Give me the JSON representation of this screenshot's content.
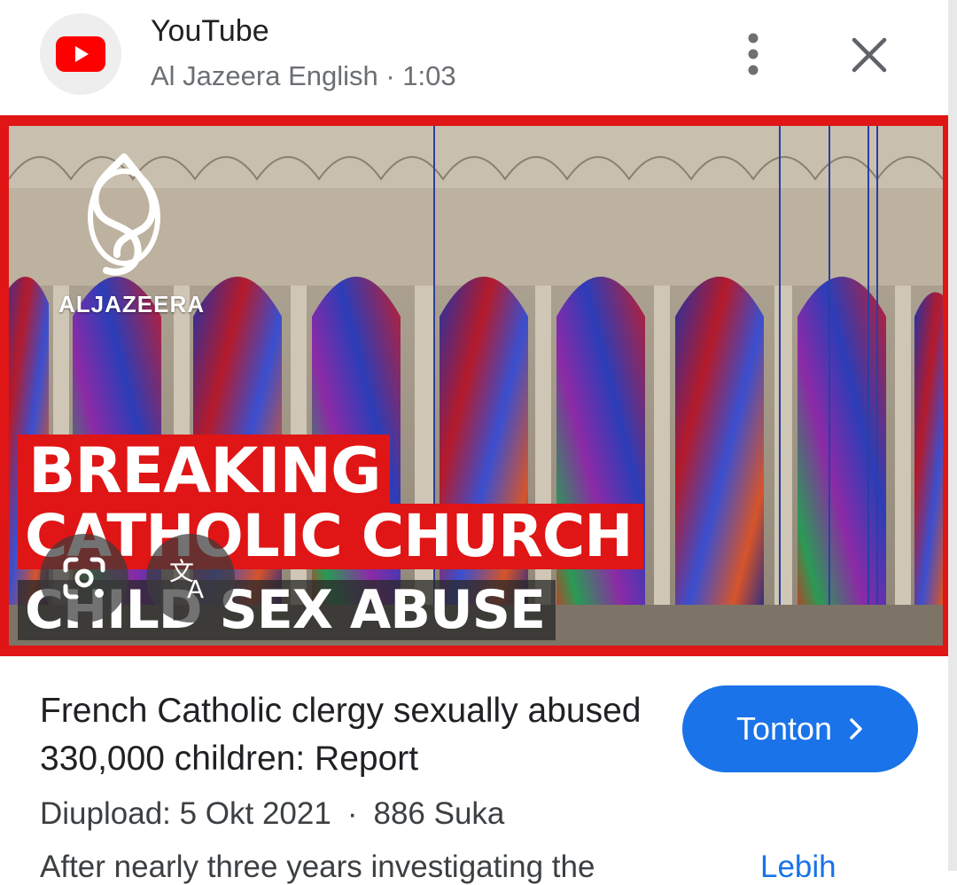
{
  "header": {
    "app_name": "YouTube",
    "subtitle": "Al Jazeera English · 1:03",
    "icons": {
      "app": "youtube-icon",
      "menu": "more-vert-icon",
      "close": "close-icon"
    }
  },
  "thumbnail": {
    "logo_text": "ALJAZEERA",
    "headline_line1": "BREAKING",
    "headline_line2": "CATHOLIC CHURCH",
    "headline_line3": "CHILD SEX ABUSE",
    "buttons": {
      "lens": "lens-icon",
      "translate": "translate-icon"
    }
  },
  "video": {
    "title": "French Catholic clergy sexually abused 330,000 children: Report",
    "upload_date": "Diupload: 5 Okt 2021",
    "likes": "886 Suka",
    "description_preview": "After nearly three years investigating the",
    "more_label": "Lebih"
  },
  "actions": {
    "watch_label": "Tonton",
    "watch_icon": "chevron-right-icon"
  },
  "colors": {
    "accent": "#1a73e8",
    "youtube_red": "#ff0000",
    "thumb_red": "#e01515"
  }
}
